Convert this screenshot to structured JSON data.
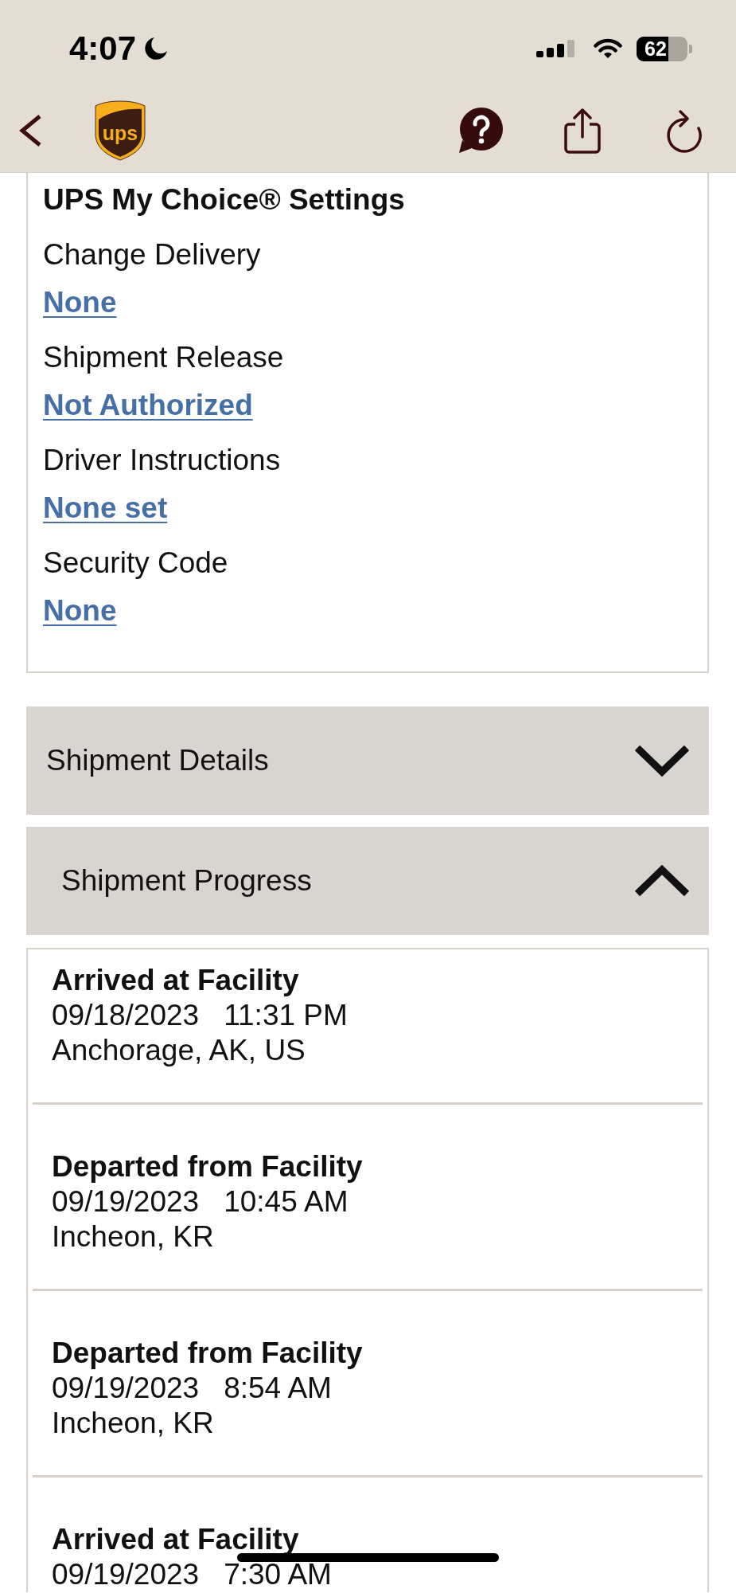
{
  "status_bar": {
    "time": "4:07",
    "battery": "62"
  },
  "nav_bar": {
    "logo_text": "ups"
  },
  "settings_card": {
    "title": "UPS My Choice® Settings",
    "settings": [
      {
        "label": "Change Delivery",
        "value": "None"
      },
      {
        "label": "Shipment Release",
        "value": "Not Authorized"
      },
      {
        "label": "Driver Instructions",
        "value": "None set"
      },
      {
        "label": "Security Code",
        "value": "None"
      }
    ]
  },
  "sections": [
    {
      "title": "Shipment Details",
      "expanded": false
    },
    {
      "title": "Shipment Progress",
      "expanded": true,
      "events": [
        {
          "status": "Arrived at Facility",
          "date": "09/18/2023",
          "time": "11:31 PM",
          "location": "Anchorage, AK, US"
        },
        {
          "status": "Departed from Facility",
          "date": "09/19/2023",
          "time": "10:45 AM",
          "location": "Incheon, KR"
        },
        {
          "status": "Departed from Facility",
          "date": "09/19/2023",
          "time": "8:54 AM",
          "location": "Incheon, KR"
        },
        {
          "status": "Arrived at Facility",
          "date": "09/19/2023",
          "time": "7:30 AM"
        }
      ]
    }
  ]
}
